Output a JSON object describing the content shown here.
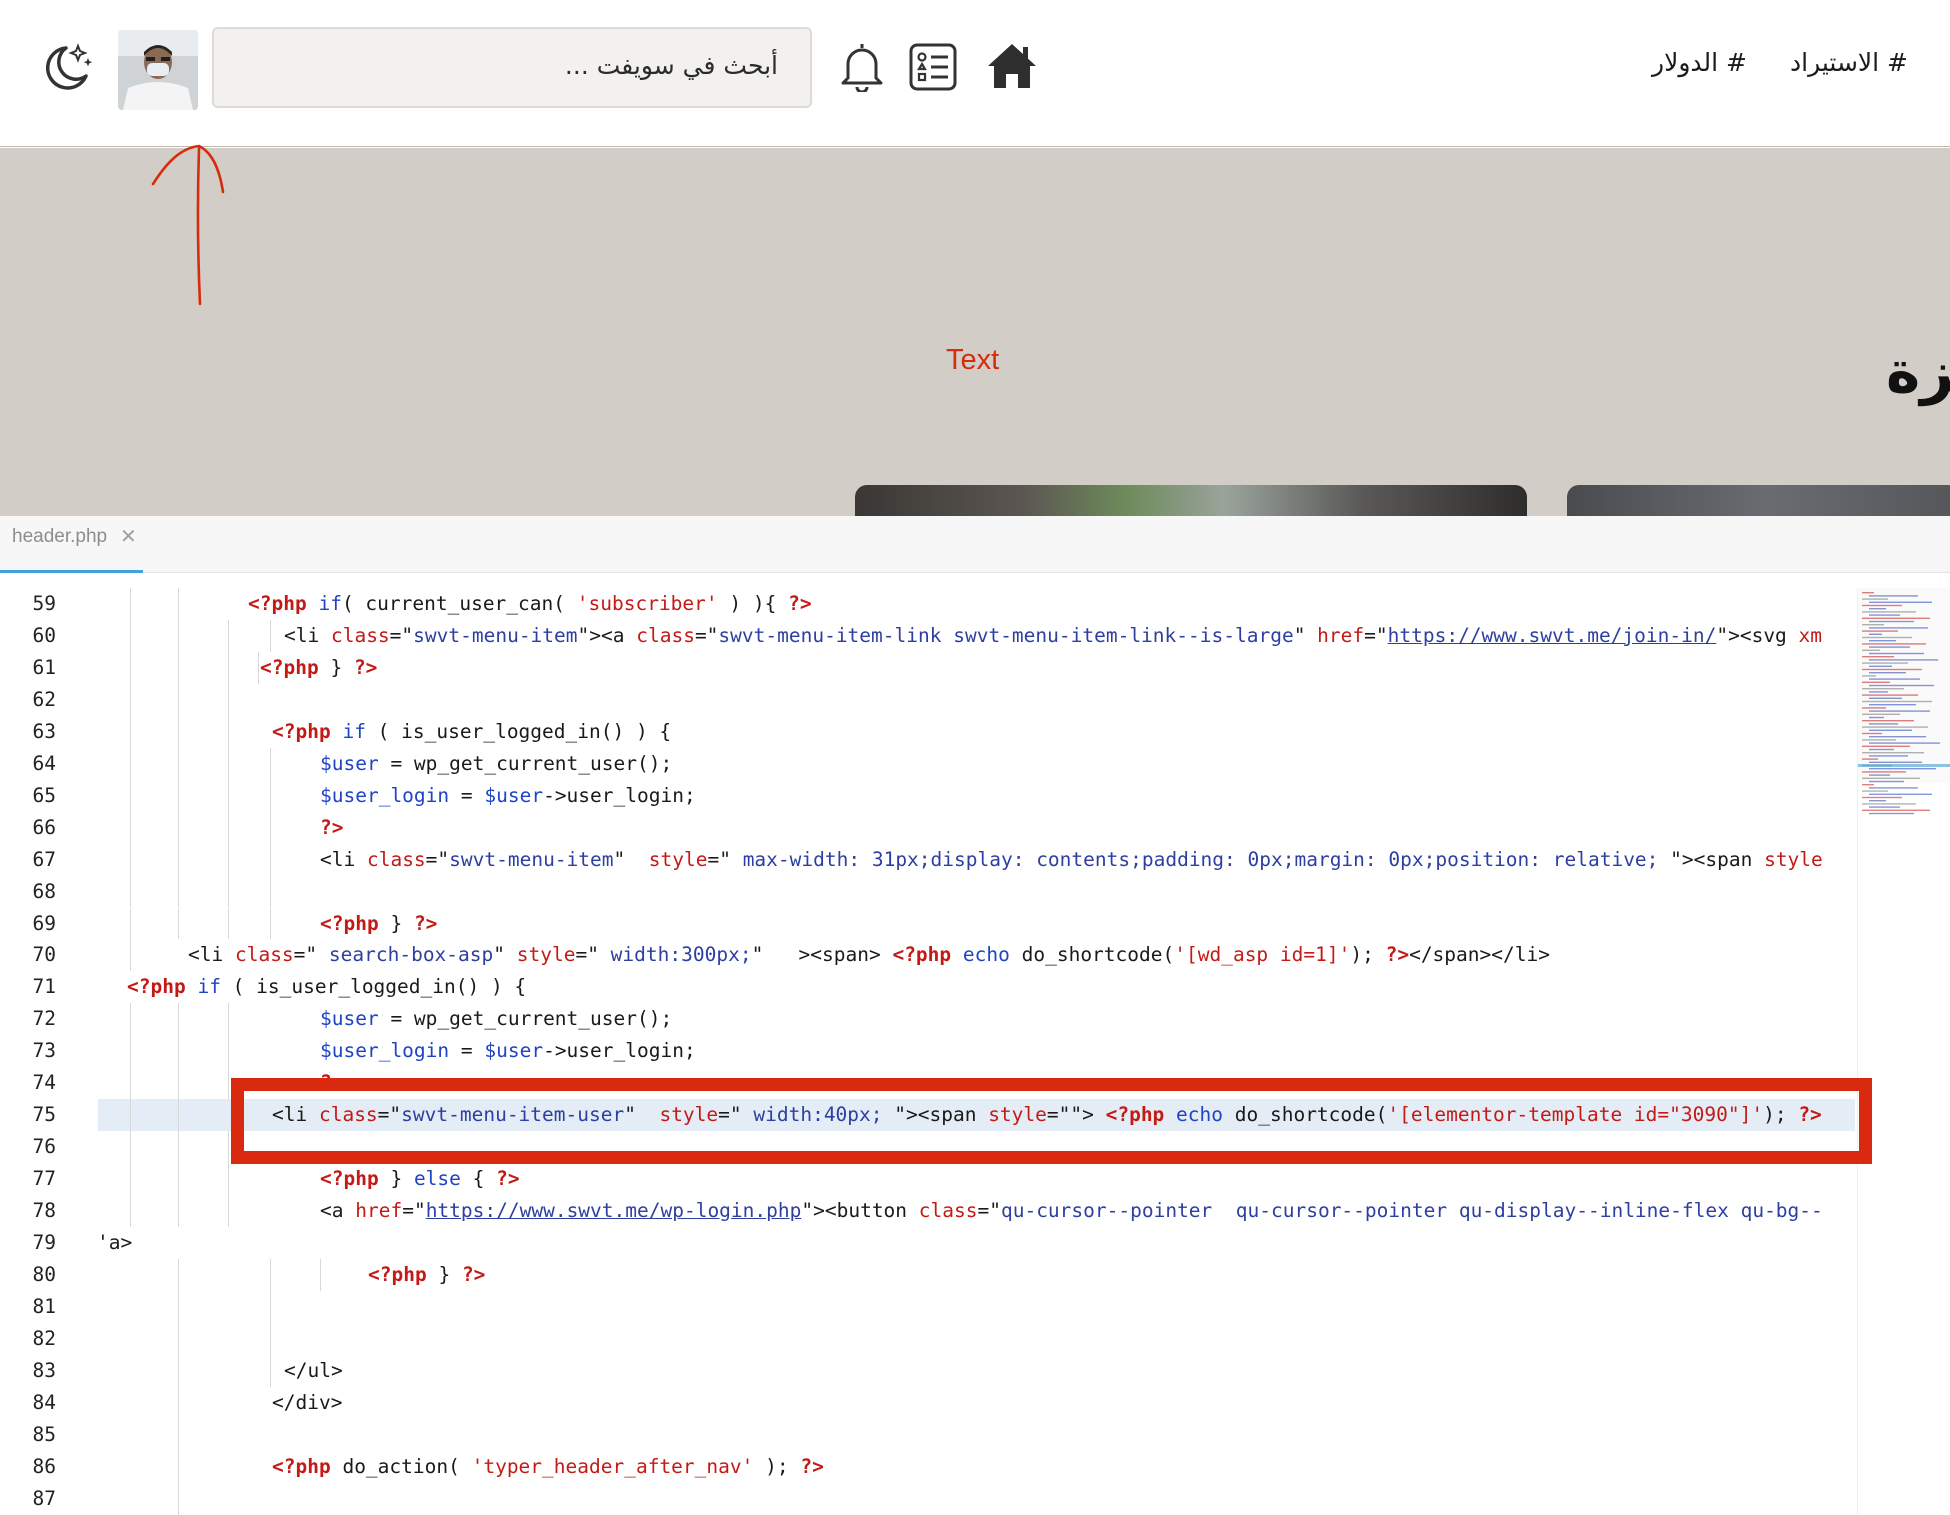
{
  "header": {
    "search_placeholder": "أبحث في سويفت ...",
    "nav": [
      "# الاستيراد",
      "# الدولار"
    ],
    "icons": [
      "moon-stars-icon",
      "avatar",
      "bell-icon",
      "list-icon",
      "home-icon"
    ]
  },
  "hero": {
    "annotation_label": "Text",
    "title_fragment": "بزة"
  },
  "editor": {
    "tab": {
      "name": "header.php",
      "close": "✕"
    },
    "accent": "#44a1dc",
    "highlight_color": "#d92a0f",
    "lines": [
      {
        "n": "59",
        "segments": [
          [
            "<?php ",
            "php"
          ],
          [
            "if",
            "blue"
          ],
          [
            "( current_user_can( ",
            "fn"
          ],
          [
            "'subscriber'",
            "str-red"
          ],
          [
            " ) ){ ",
            "fn"
          ],
          [
            "?>",
            "php"
          ]
        ]
      },
      {
        "n": "60",
        "segments": [
          [
            "<li ",
            "fn"
          ],
          [
            "class",
            "attr"
          ],
          [
            "=\"",
            "fn"
          ],
          [
            "swvt-menu-item",
            "str"
          ],
          [
            "\"><a ",
            "fn"
          ],
          [
            "class",
            "attr"
          ],
          [
            "=\"",
            "fn"
          ],
          [
            "swvt-menu-item-link swvt-menu-item-link--is-large",
            "str"
          ],
          [
            "\" ",
            "fn"
          ],
          [
            "href",
            "attr"
          ],
          [
            "=\"",
            "fn"
          ],
          [
            "https://www.swvt.me/join-in/",
            "url"
          ],
          [
            "\"><svg ",
            "fn"
          ],
          [
            "xm",
            "attr"
          ]
        ]
      },
      {
        "n": "61",
        "segments": [
          [
            "<?php",
            "php"
          ],
          [
            " } ",
            "fn"
          ],
          [
            "?>",
            "php"
          ]
        ]
      },
      {
        "n": "62",
        "segments": []
      },
      {
        "n": "63",
        "segments": [
          [
            "<?php ",
            "php"
          ],
          [
            "if",
            "blue"
          ],
          [
            " ( is_user_logged_in() ) {",
            "fn"
          ]
        ]
      },
      {
        "n": "64",
        "segments": [
          [
            "$user",
            "blue"
          ],
          [
            " = wp_get_current_user();",
            "fn"
          ]
        ]
      },
      {
        "n": "65",
        "segments": [
          [
            "$user_login",
            "blue"
          ],
          [
            " = ",
            "fn"
          ],
          [
            "$user",
            "blue"
          ],
          [
            "->user_login;",
            "fn"
          ]
        ]
      },
      {
        "n": "66",
        "segments": [
          [
            "?>",
            "php"
          ]
        ]
      },
      {
        "n": "67",
        "segments": [
          [
            "<li ",
            "fn"
          ],
          [
            "class",
            "attr"
          ],
          [
            "=\"",
            "fn"
          ],
          [
            "swvt-menu-item",
            "str"
          ],
          [
            "\"  ",
            "fn"
          ],
          [
            "style",
            "attr"
          ],
          [
            "=\"",
            "fn"
          ],
          [
            " max-width: 31px;display: contents;padding: 0px;margin: 0px;position: relative; ",
            "str"
          ],
          [
            "\"><span ",
            "fn"
          ],
          [
            "style",
            "attr"
          ]
        ]
      },
      {
        "n": "68",
        "segments": []
      },
      {
        "n": "69",
        "segments": [
          [
            "<?php",
            "php"
          ],
          [
            " } ",
            "fn"
          ],
          [
            "?>",
            "php"
          ]
        ]
      },
      {
        "n": "70",
        "segments": [
          [
            "<li ",
            "fn"
          ],
          [
            "class",
            "attr"
          ],
          [
            "=\"",
            "fn"
          ],
          [
            " search-box-asp",
            "str"
          ],
          [
            "\" ",
            "fn"
          ],
          [
            "style",
            "attr"
          ],
          [
            "=\"",
            "fn"
          ],
          [
            " width:300px;",
            "str"
          ],
          [
            "\"   ><span> ",
            "fn"
          ],
          [
            "<?php ",
            "php"
          ],
          [
            "echo",
            "blue"
          ],
          [
            " do_shortcode(",
            "fn"
          ],
          [
            "'[wd_asp id=1]'",
            "str-red"
          ],
          [
            "); ",
            "fn"
          ],
          [
            "?>",
            "php"
          ],
          [
            "</span></li>",
            "fn"
          ]
        ]
      },
      {
        "n": "71",
        "segments": [
          [
            "<?php ",
            "php"
          ],
          [
            "if",
            "blue"
          ],
          [
            " ( is_user_logged_in() ) {",
            "fn"
          ]
        ]
      },
      {
        "n": "72",
        "segments": [
          [
            "$user",
            "blue"
          ],
          [
            " = wp_get_current_user();",
            "fn"
          ]
        ]
      },
      {
        "n": "73",
        "segments": [
          [
            "$user_login",
            "blue"
          ],
          [
            " = ",
            "fn"
          ],
          [
            "$user",
            "blue"
          ],
          [
            "->user_login;",
            "fn"
          ]
        ]
      },
      {
        "n": "74",
        "segments": [
          [
            "?",
            "php"
          ]
        ]
      },
      {
        "n": "75",
        "segments": [
          [
            "<li ",
            "fn"
          ],
          [
            "class",
            "attr"
          ],
          [
            "=\"",
            "fn"
          ],
          [
            "swvt-menu-item-user",
            "str"
          ],
          [
            "\"  ",
            "fn"
          ],
          [
            "style",
            "attr"
          ],
          [
            "=\"",
            "fn"
          ],
          [
            " width:40px; ",
            "str"
          ],
          [
            "\"><span ",
            "fn"
          ],
          [
            "style",
            "attr"
          ],
          [
            "=\"\"> ",
            "fn"
          ],
          [
            "<?php ",
            "php"
          ],
          [
            "echo",
            "blue"
          ],
          [
            " do_shortcode(",
            "fn"
          ],
          [
            "'[elementor-template id=\"3090\"]'",
            "str-red"
          ],
          [
            "); ",
            "fn"
          ],
          [
            "?>",
            "php"
          ]
        ]
      },
      {
        "n": "76",
        "segments": []
      },
      {
        "n": "77",
        "segments": [
          [
            "<?php",
            "php"
          ],
          [
            " } ",
            "fn"
          ],
          [
            "else",
            "blue"
          ],
          [
            " { ",
            "fn"
          ],
          [
            "?>",
            "php"
          ]
        ]
      },
      {
        "n": "78",
        "segments": [
          [
            "<a ",
            "fn"
          ],
          [
            "href",
            "attr"
          ],
          [
            "=\"",
            "fn"
          ],
          [
            "https://www.swvt.me/wp-login.php",
            "url"
          ],
          [
            "\"><button ",
            "fn"
          ],
          [
            "class",
            "attr"
          ],
          [
            "=\"",
            "fn"
          ],
          [
            "qu-cursor--pointer  qu-cursor--pointer qu-display--inline-flex qu-bg--",
            "str"
          ]
        ]
      },
      {
        "n": "79",
        "segments": [
          [
            "'a>",
            "fn"
          ]
        ]
      },
      {
        "n": "80",
        "segments": [
          [
            "<?php",
            "php"
          ],
          [
            " } ",
            "fn"
          ],
          [
            "?>",
            "php"
          ]
        ]
      },
      {
        "n": "81",
        "segments": []
      },
      {
        "n": "82",
        "segments": []
      },
      {
        "n": "83",
        "segments": [
          [
            "</ul>",
            "fn"
          ]
        ]
      },
      {
        "n": "84",
        "segments": [
          [
            "</div>",
            "fn"
          ]
        ]
      },
      {
        "n": "85",
        "segments": []
      },
      {
        "n": "86",
        "segments": [
          [
            "<?php ",
            "php"
          ],
          [
            "do_action( ",
            "fn"
          ],
          [
            "'typer_header_after_nav'",
            "str-red"
          ],
          [
            " ); ",
            "fn"
          ],
          [
            "?>",
            "php"
          ]
        ]
      },
      {
        "n": "87",
        "segments": []
      }
    ]
  }
}
